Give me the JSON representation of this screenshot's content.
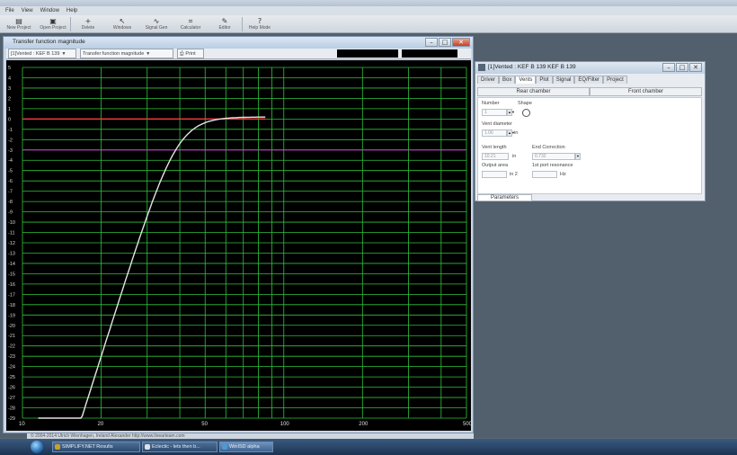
{
  "menu": [
    "File",
    "View",
    "Window",
    "Help"
  ],
  "toolbar": [
    {
      "label": "New Project",
      "icon": "▤"
    },
    {
      "label": "Open Project",
      "icon": "▣"
    },
    {
      "label": "Delete",
      "icon": "+"
    },
    {
      "label": "Windows",
      "icon": "↖"
    },
    {
      "label": "Signal Gen",
      "icon": "∿"
    },
    {
      "label": "Calculator",
      "icon": "⌗"
    },
    {
      "label": "Editor",
      "icon": "✎"
    },
    {
      "label": "Help Mode",
      "icon": "?"
    }
  ],
  "tf_window": {
    "title": "Transfer function magnitude",
    "project_combo": "[1]Vented : KEF B 139",
    "view_combo": "Transfer function magnitude",
    "print": "Print",
    "buttons": {
      "min": "–",
      "max": "□",
      "close": "✕"
    }
  },
  "plot": {
    "y_ticks": [
      "5",
      "4",
      "3",
      "2",
      "1",
      "0",
      "-1",
      "-2",
      "-3",
      "-4",
      "-5",
      "-6",
      "-7",
      "-8",
      "-9",
      "-10",
      "-11",
      "-12",
      "-13",
      "-14",
      "-15",
      "-16",
      "-17",
      "-18",
      "-19",
      "-20",
      "-21",
      "-22",
      "-23",
      "-24",
      "-25",
      "-26",
      "-27",
      "-28",
      "-29"
    ],
    "x_ticks": [
      "10",
      "20",
      "50",
      "100",
      "200",
      "500"
    ],
    "colors": {
      "grid": "#2fc23a",
      "curve": "#e4e4e4",
      "red_line": "#ff3a3a",
      "magenta_line": "#d83ad8",
      "background": "#000000"
    }
  },
  "vented": {
    "title": "[1]Vented : KEF B 139 KEF B 139",
    "tabs": [
      "Driver",
      "Box",
      "Vents",
      "Plot",
      "Signal",
      "EQ/Filter",
      "Project"
    ],
    "active_tab": "Vents",
    "chambers": [
      "Rear chamber",
      "Front chamber"
    ],
    "number_label": "Number",
    "number_value": "1",
    "shape_label": "Shape",
    "diameter_label": "Vent diameter",
    "diameter_value": "1.06",
    "diameter_unit": "in",
    "length_label": "Vent length",
    "length_value": "10.21",
    "length_unit": "in",
    "end_correction_label": "End Correction",
    "end_correction_value": "0.732",
    "output_label": "Output area",
    "output_unit": "in 2",
    "resonance_label": "1st port resonance",
    "resonance_unit": "Hz",
    "params_tab": "Parameters",
    "buttons": {
      "min": "–",
      "max": "□",
      "close": "✕"
    }
  },
  "statusbar": "© 2004-2014 Ulrich Wienhagen, Ireland Alexander http://www.linearteam.com",
  "taskbar": {
    "items": [
      {
        "label": "SIMPLIFY.NET Results",
        "color": "#c8a030"
      },
      {
        "label": "Eclectic - lets then b...",
        "color": "#e0e0e0"
      },
      {
        "label": "WinISD alpha",
        "color": "#4a9ad8"
      }
    ]
  }
}
